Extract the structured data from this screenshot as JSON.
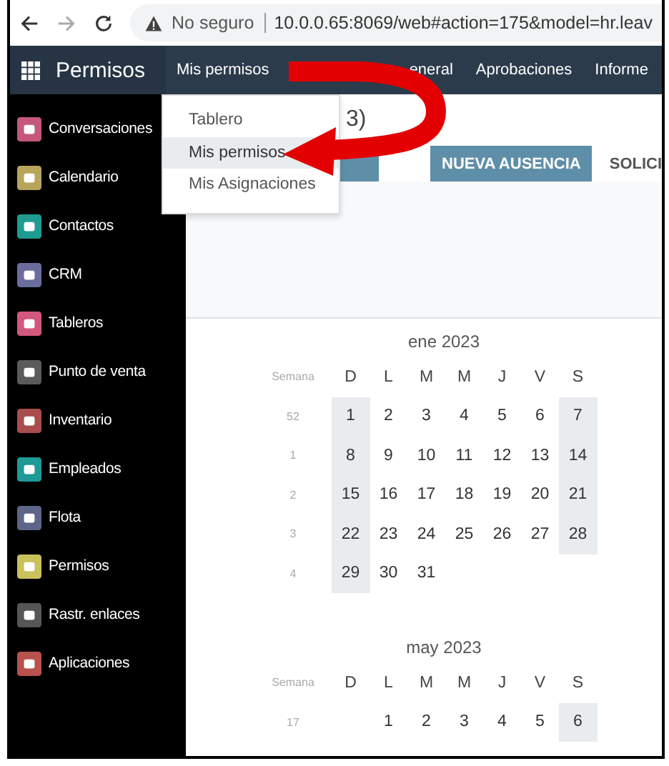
{
  "browser": {
    "security": "No seguro",
    "url": "10.0.0.65:8069/web#action=175&model=hr.leav"
  },
  "navbar": {
    "app": "Permisos",
    "menus": [
      {
        "label": "Mis permisos"
      },
      {
        "label": "eneral"
      },
      {
        "label": "Aprobaciones"
      },
      {
        "label": "Informe"
      }
    ]
  },
  "dropdown": [
    {
      "label": "Tablero",
      "selected": false
    },
    {
      "label": "Mis permisos",
      "selected": true
    },
    {
      "label": "Mis Asignaciones",
      "selected": false
    }
  ],
  "sidebar": [
    {
      "label": "Conversaciones",
      "color": "#c4577b"
    },
    {
      "label": "Calendario",
      "color": "#b8a55c"
    },
    {
      "label": "Contactos",
      "color": "#1f9c91"
    },
    {
      "label": "CRM",
      "color": "#6b6d9c"
    },
    {
      "label": "Tableros",
      "color": "#d2587d"
    },
    {
      "label": "Punto de venta",
      "color": "#5b5b5b"
    },
    {
      "label": "Inventario",
      "color": "#a94d4d"
    },
    {
      "label": "Empleados",
      "color": "#1f9a97"
    },
    {
      "label": "Flota",
      "color": "#5d6589"
    },
    {
      "label": "Permisos",
      "color": "#c9c15c"
    },
    {
      "label": "Rastr. enlaces",
      "color": "#565656"
    },
    {
      "label": "Aplicaciones",
      "color": "#b9514f"
    }
  ],
  "control_panel": {
    "title": "3)",
    "new_button": "NUEVA AUSENCIA",
    "next_link": "SOLICI"
  },
  "calendars": [
    {
      "title": "ene 2023",
      "week_label": "Semana",
      "weekdays": [
        "D",
        "L",
        "M",
        "M",
        "J",
        "V",
        "S"
      ],
      "weeks": [
        {
          "number": "52",
          "days": [
            {
              "kind": "date",
              "label": "1",
              "weekend": true
            },
            {
              "kind": "date",
              "label": "2",
              "weekend": false
            },
            {
              "kind": "date",
              "label": "3",
              "weekend": false
            },
            {
              "kind": "date",
              "label": "4",
              "weekend": false
            },
            {
              "kind": "date",
              "label": "5",
              "weekend": false
            },
            {
              "kind": "date",
              "label": "6",
              "weekend": false
            },
            {
              "kind": "date",
              "label": "7",
              "weekend": true
            }
          ]
        },
        {
          "number": "1",
          "days": [
            {
              "kind": "date",
              "label": "8",
              "weekend": true
            },
            {
              "kind": "date",
              "label": "9",
              "weekend": false
            },
            {
              "kind": "date",
              "label": "10",
              "weekend": false
            },
            {
              "kind": "date",
              "label": "11",
              "weekend": false
            },
            {
              "kind": "date",
              "label": "12",
              "weekend": false
            },
            {
              "kind": "date",
              "label": "13",
              "weekend": false
            },
            {
              "kind": "date",
              "label": "14",
              "weekend": true
            }
          ]
        },
        {
          "number": "2",
          "days": [
            {
              "kind": "date",
              "label": "15",
              "weekend": true
            },
            {
              "kind": "date",
              "label": "16",
              "weekend": false
            },
            {
              "kind": "date",
              "label": "17",
              "weekend": false
            },
            {
              "kind": "date",
              "label": "18",
              "weekend": false
            },
            {
              "kind": "date",
              "label": "19",
              "weekend": false
            },
            {
              "kind": "date",
              "label": "20",
              "weekend": false
            },
            {
              "kind": "date",
              "label": "21",
              "weekend": true
            }
          ]
        },
        {
          "number": "3",
          "days": [
            {
              "kind": "date",
              "label": "22",
              "weekend": true
            },
            {
              "kind": "date",
              "label": "23",
              "weekend": false
            },
            {
              "kind": "date",
              "label": "24",
              "weekend": false
            },
            {
              "kind": "date",
              "label": "25",
              "weekend": false
            },
            {
              "kind": "date",
              "label": "26",
              "weekend": false
            },
            {
              "kind": "date",
              "label": "27",
              "weekend": false
            },
            {
              "kind": "date",
              "label": "28",
              "weekend": true
            }
          ]
        },
        {
          "number": "4",
          "days": [
            {
              "kind": "date",
              "label": "29",
              "weekend": true
            },
            {
              "kind": "date",
              "label": "30",
              "weekend": false
            },
            {
              "kind": "date",
              "label": "31",
              "weekend": false
            }
          ]
        }
      ]
    },
    {
      "title": "may 2023",
      "week_label": "Semana",
      "weekdays": [
        "D",
        "L",
        "M",
        "M",
        "J",
        "V",
        "S"
      ],
      "weeks": [
        {
          "number": "17",
          "days": [
            {
              "kind": "blank"
            },
            {
              "kind": "date",
              "label": "1",
              "weekend": false
            },
            {
              "kind": "date",
              "label": "2",
              "weekend": false
            },
            {
              "kind": "date",
              "label": "3",
              "weekend": false
            },
            {
              "kind": "date",
              "label": "4",
              "weekend": false
            },
            {
              "kind": "date",
              "label": "5",
              "weekend": false
            },
            {
              "kind": "date",
              "label": "6",
              "weekend": true
            }
          ]
        }
      ]
    }
  ]
}
